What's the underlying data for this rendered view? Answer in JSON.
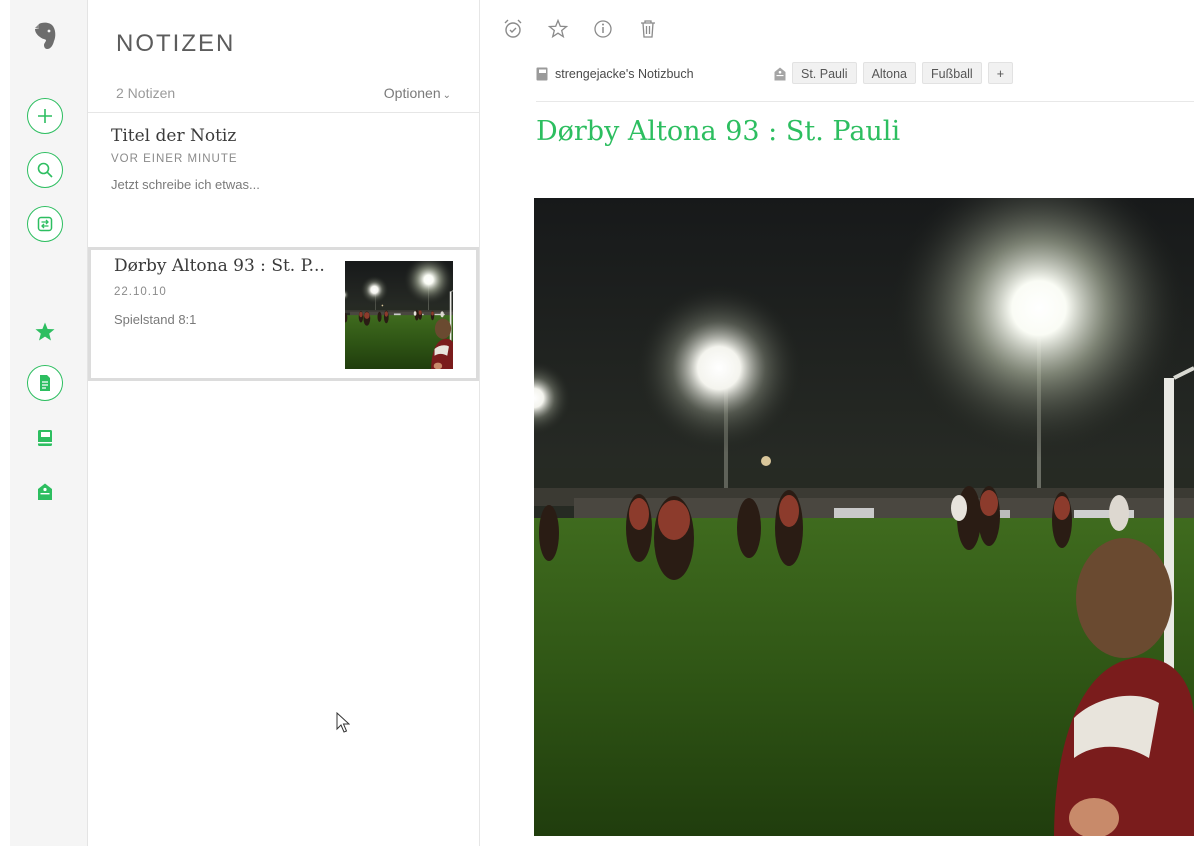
{
  "app": {
    "brand_color": "#2dbe60"
  },
  "rail": {
    "icons": [
      "elephant-logo-icon",
      "plus-icon",
      "search-icon",
      "work-chat-icon",
      "star-icon",
      "notes-icon",
      "notebook-icon",
      "tag-icon"
    ]
  },
  "note_list": {
    "title": "NOTIZEN",
    "count_label": "2 Notizen",
    "options_label": "Optionen",
    "notes": [
      {
        "title": "Titel der Notiz",
        "date": "VOR EINER MINUTE",
        "snippet": "Jetzt schreibe ich etwas..."
      },
      {
        "title": "Dørby Altona 93 : St. P...",
        "date": "22.10.10",
        "snippet": "Spielstand 8:1",
        "selected": true,
        "thumbnail": "night-football-photo"
      }
    ]
  },
  "editor": {
    "toolbar_icons": [
      "reminder-icon",
      "shortcut-star-icon",
      "info-icon",
      "trash-icon"
    ],
    "notebook": "strengejacke's Notizbuch",
    "tags": [
      "St. Pauli",
      "Altona",
      "Fußball"
    ],
    "add_tag_label": "+",
    "note_title": "Dørby Altona 93 : St. Pauli",
    "image": "night-football-photo"
  }
}
